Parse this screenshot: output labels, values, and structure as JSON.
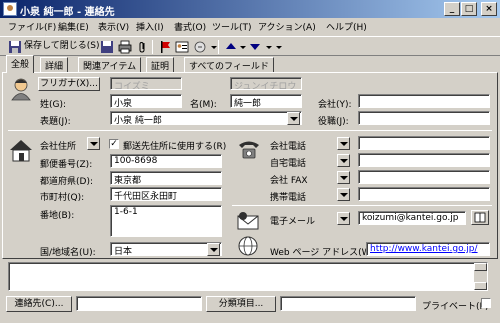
{
  "window": {
    "title": "小泉 純一郎 - 連絡先",
    "min": "_",
    "max": "□",
    "close": "×"
  },
  "menu": [
    "ファイル(F)",
    "編集(E)",
    "表示(V)",
    "挿入(I)",
    "書式(O)",
    "ツール(T)",
    "アクション(A)",
    "ヘルプ(H)"
  ],
  "toolbar": {
    "save_close": "保存して閉じる(S)"
  },
  "tabs": [
    "全般",
    "詳細",
    "関連アイテム",
    "証明",
    "すべてのフィールド"
  ],
  "name": {
    "furigana_button": "フリガナ(X)...",
    "furigana_last": "コイズミ",
    "furigana_first": "ジュンイチロウ",
    "last_label": "姓(G):",
    "last_value": "小泉",
    "first_label": "名(M):",
    "first_value": "純一郎",
    "company_label": "会社(Y):",
    "company_value": "",
    "display_label": "表題(J):",
    "display_value": "小泉 純一郎",
    "title_label": "役職(J):",
    "title_value": ""
  },
  "address": {
    "type_label": "会社住所",
    "mailing_checkbox": "郵送先住所に使用する(R)",
    "mailing_checked": "✓",
    "postal_label": "郵便番号(Z):",
    "postal_value": "100-8698",
    "prefecture_label": "都道府県(D):",
    "prefecture_value": "東京都",
    "city_label": "市町村(Q):",
    "city_value": "千代田区永田町",
    "street_label": "番地(B):",
    "street_value": "1-6-1",
    "country_label": "国/地域名(U):",
    "country_value": "日本"
  },
  "phones": [
    {
      "label": "会社電話",
      "value": ""
    },
    {
      "label": "自宅電話",
      "value": ""
    },
    {
      "label": "会社 FAX",
      "value": ""
    },
    {
      "label": "携帯電話",
      "value": ""
    }
  ],
  "email": {
    "label": "電子メール",
    "value": "koizumi@kantei.go.jp"
  },
  "web": {
    "label": "Web ページ アドレス(W):",
    "value": "http://www.kantei.go.jp/"
  },
  "footer": {
    "contacts_button": "連絡先(C)...",
    "categories_button": "分類項目...",
    "private_label": "プライベート(P)"
  }
}
